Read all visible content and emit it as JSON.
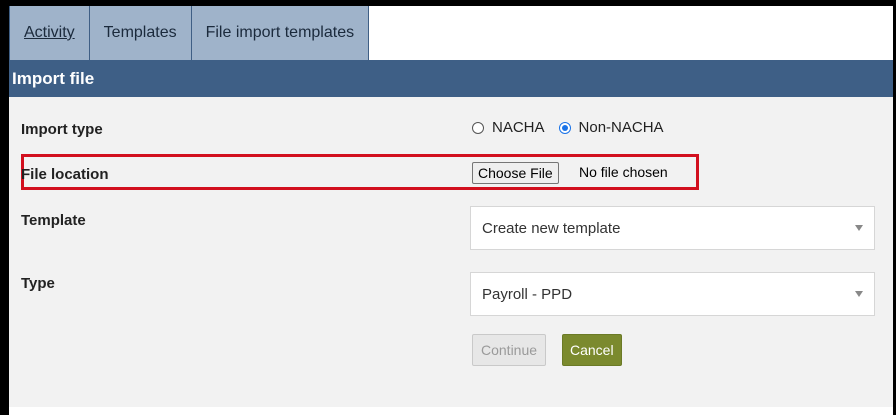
{
  "tabs": [
    {
      "label": "Activity"
    },
    {
      "label": "Templates"
    },
    {
      "label": "File import templates"
    }
  ],
  "header": {
    "title": "Import file"
  },
  "form": {
    "import_type": {
      "label": "Import type",
      "options": [
        {
          "label": "NACHA",
          "checked": false
        },
        {
          "label": "Non-NACHA",
          "checked": true
        }
      ]
    },
    "file_location": {
      "label": "File location",
      "button_label": "Choose File",
      "status": "No file chosen"
    },
    "template": {
      "label": "Template",
      "value": "Create new template"
    },
    "type": {
      "label": "Type",
      "value": "Payroll - PPD"
    }
  },
  "buttons": {
    "continue": "Continue",
    "cancel": "Cancel"
  },
  "colors": {
    "header_bg": "#3e5f86",
    "tab_bg": "#9fb3ca",
    "highlight": "#d20f1e",
    "cancel_bg": "#7b8a2e"
  }
}
